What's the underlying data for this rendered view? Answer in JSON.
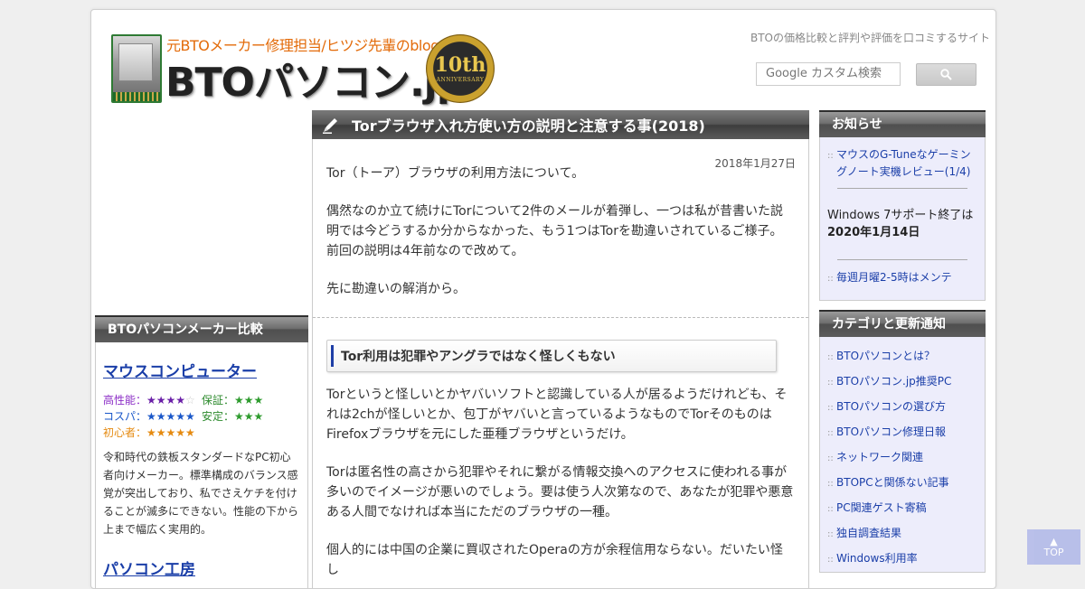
{
  "header": {
    "tagline": "元BTOメーカー修理担当/ヒツジ先輩のblog",
    "site_name": "BTOパソコン.jp",
    "badge_number": "10th",
    "badge_text": "ANNIVERSARY",
    "site_description": "BTOの価格比較と評判や評価を口コミするサイト",
    "search_placeholder": "Google カスタム検索"
  },
  "left": {
    "heading": "BTOパソコンメーカー比較",
    "makers": [
      {
        "name": "マウスコンピューター",
        "ratings": [
          {
            "label": "高性能：",
            "stars": "★★★★",
            "empty": "☆"
          },
          {
            "label": "保証：",
            "stars": "★★★",
            "empty": ""
          },
          {
            "label": "コスパ：",
            "stars": "★★★★★",
            "empty": ""
          },
          {
            "label": "安定：",
            "stars": "★★★",
            "empty": ""
          },
          {
            "label": "初心者：",
            "stars": "★★★★★",
            "empty": ""
          }
        ],
        "description": "令和時代の鉄板スタンダードなPC初心者向けメーカー。標準構成のバランス感覚が突出しており、私でさえケチを付けることが滅多にできない。性能の下から上まで幅広く実用的。"
      },
      {
        "name": "パソコン工房"
      }
    ]
  },
  "main": {
    "title": "Torブラウザ入れ方使い方の説明と注意する事(2018)",
    "date": "2018年1月27日",
    "paragraphs": [
      "Tor（トーア）ブラウザの利用方法について。",
      "偶然なのか立て続けにTorについて2件のメールが着弾し、一つは私が昔書いた説明では今どうするか分からなかった、もう1つはTorを勘違いされているご様子。前回の説明は4年前なので改めて。",
      "先に勘違いの解消から。"
    ],
    "subheading": "Tor利用は犯罪やアングラではなく怪しくもない",
    "paragraphs2": [
      "Torというと怪しいとかヤバいソフトと認識している人が居るようだけれども、それは2chが怪しいとか、包丁がヤバいと言っているようなものでTorそのものはFirefoxブラウザを元にした亜種ブラウザというだけ。",
      "Torは匿名性の高さから犯罪やそれに繋がる情報交換へのアクセスに使われる事が多いのでイメージが悪いのでしょう。要は使う人次第なので、あなたが犯罪や悪意ある人間でなければ本当にただのブラウザの一種。",
      "個人的には中国の企業に買収されたOperaの方が余程信用ならない。だいたい怪し"
    ]
  },
  "right": {
    "news_heading": "お知らせ",
    "news_link1": "マウスのG-Tuneなゲーミングノート実機レビュー(1/4)",
    "news_text_prefix": "Windows 7サポート終了は",
    "news_text_bold": "2020年1月14日",
    "news_link2": "毎週月曜2-5時はメンテ",
    "category_heading": "カテゴリと更新通知",
    "categories": [
      "BTOパソコンとは？",
      "BTOパソコン.jp推奨PC",
      "BTOパソコンの選び方",
      "BTOパソコン修理日報",
      "ネットワーク関連",
      "BTOPCと関係ない記事",
      "PC関連ゲスト寄稿",
      "独自調査結果",
      "Windows利用率"
    ]
  },
  "top_button": {
    "arrow": "▲",
    "label": "TOP"
  }
}
